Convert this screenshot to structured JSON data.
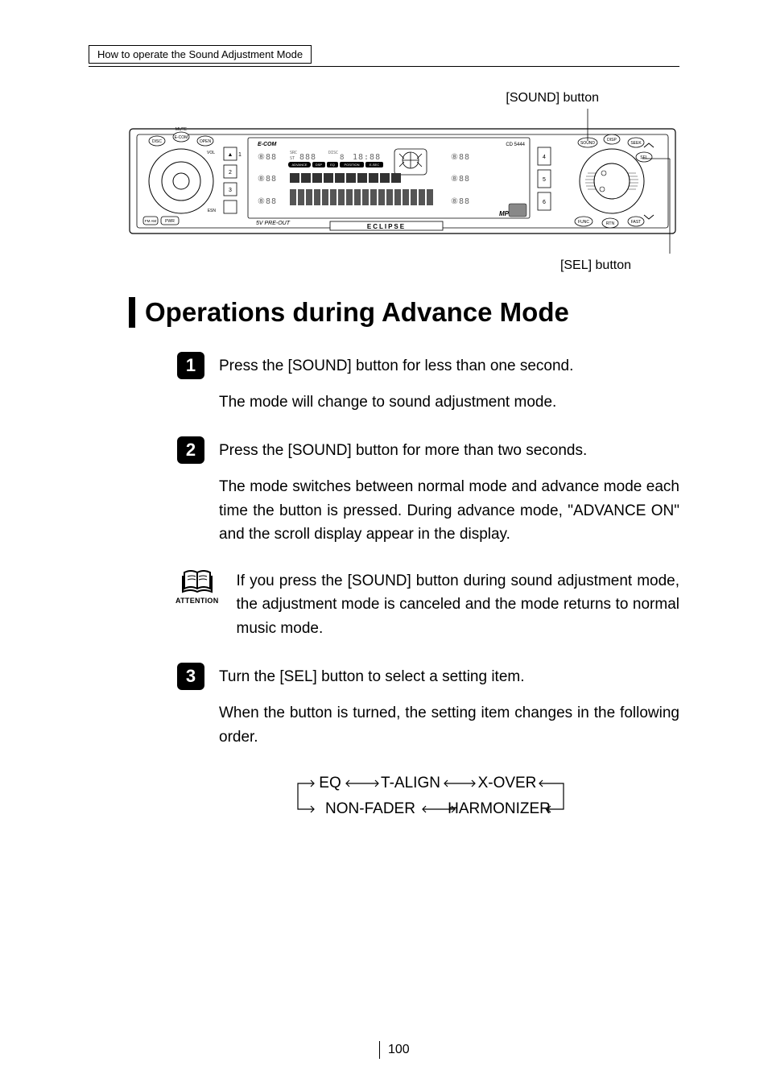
{
  "breadcrumb": "How to operate the Sound Adjustment Mode",
  "callouts": {
    "sound_button": "[SOUND] button",
    "sel_button": "[SEL] button"
  },
  "diagram": {
    "model": "CD 5444",
    "brand_sub": "E-COM",
    "brand_bottom": "ECLIPSE",
    "face_buttons_left": [
      "DISC",
      "E-COM",
      "OPEN"
    ],
    "preout": "5V PRE-OUT",
    "mp3": "MP3",
    "fm_am": "FM\nAM",
    "pwr": "PWR",
    "mute": "MUTE",
    "vol": "VOL",
    "knob_labels_right": [
      "SOUND",
      "DISP",
      "SEEK",
      "SEL",
      "FUNC",
      "RTN",
      "FAST"
    ],
    "indicator_tags": [
      "ADVANCE",
      "DSP",
      "EQ",
      "POSITION",
      "E-SEC"
    ],
    "seg_src": "SRC",
    "seg_disc": "DISC",
    "seg_st": "ST",
    "preset_left": [
      "1",
      "2",
      "3"
    ],
    "preset_right": [
      "4",
      "5",
      "6"
    ],
    "eject": "▲",
    "esn": "ESN"
  },
  "section_title": "Operations during Advance Mode",
  "steps": [
    {
      "num": "1",
      "instruction": "Press the [SOUND] button for less than one second.",
      "body": "The mode will change to sound adjustment mode."
    },
    {
      "num": "2",
      "instruction": "Press the [SOUND] button for more than two seconds.",
      "body": "The mode switches between normal mode and advance mode each time the button is pressed. During advance mode, \"ADVANCE  ON\" and the scroll display appear in the display."
    },
    {
      "num": "3",
      "instruction": "Turn the [SEL] button to select a setting item.",
      "body": "When the button is turned, the setting item changes in the following order."
    }
  ],
  "attention": {
    "label": "ATTENTION",
    "text": "If you press the [SOUND] button during sound adjustment mode, the adjustment mode is canceled and the mode returns to normal music mode."
  },
  "cycle": {
    "row1": [
      "EQ",
      "T-ALIGN",
      "X-OVER"
    ],
    "row2": [
      "NON-FADER",
      "HARMONIZER"
    ]
  },
  "page_number": "100"
}
